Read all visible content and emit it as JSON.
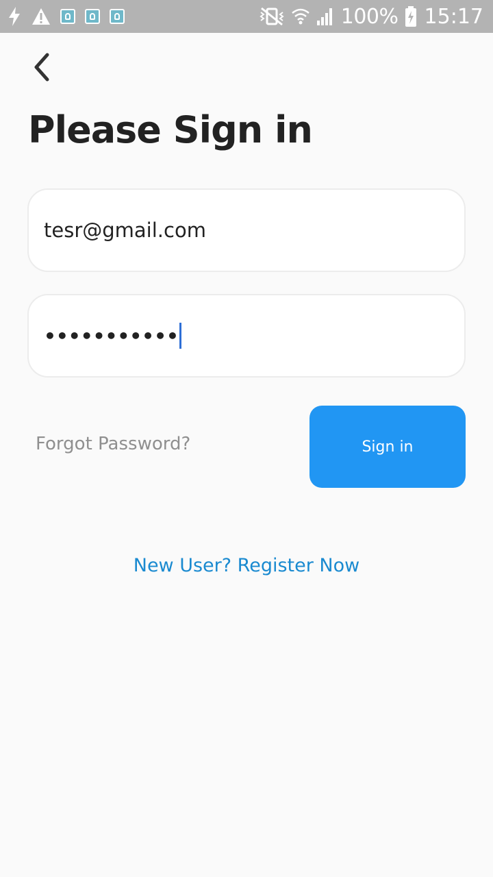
{
  "status_bar": {
    "battery_text": "100%",
    "time": "15:17",
    "icons": [
      "charging-bolt-icon",
      "warning-icon",
      "app-notification-icon",
      "app-notification-icon",
      "app-notification-icon",
      "vibrate-icon",
      "wifi-icon",
      "signal-icon",
      "battery-icon"
    ]
  },
  "header": {
    "back_icon": "chevron-left-icon",
    "title": "Please Sign in"
  },
  "form": {
    "email_value": "tesr@gmail.com",
    "password_masked": "•••••••••••"
  },
  "actions": {
    "forgot_label": "Forgot Password?",
    "signin_label": "Sign in",
    "register_label": "New User? Register Now"
  },
  "colors": {
    "background": "#fafafa",
    "status_bar": "#b3b3b3",
    "primary_button": "#2196f3",
    "link": "#1a8ad0",
    "muted_text": "#8f8f8f",
    "caret": "#2e6fd6"
  }
}
